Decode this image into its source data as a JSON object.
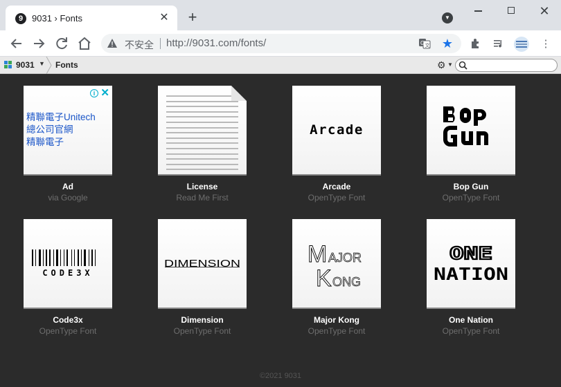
{
  "browser": {
    "tab_title": "9031 › Fonts",
    "tab_favicon": "9",
    "new_tab": "+",
    "close_tab": "✕",
    "security_label": "不安全",
    "url": "http://9031.com/fonts/"
  },
  "site": {
    "name": "9031",
    "breadcrumb": "Fonts",
    "search_value": ""
  },
  "ad": {
    "lines": [
      "精聯電子Unitech",
      "總公司官網",
      "精聯電子"
    ]
  },
  "tiles": [
    {
      "title": "Ad",
      "subtitle": "via Google",
      "preview": "ad"
    },
    {
      "title": "License",
      "subtitle": "Read Me First",
      "preview": "license"
    },
    {
      "title": "Arcade",
      "subtitle": "OpenType Font",
      "preview_text": "Arcade"
    },
    {
      "title": "Bop Gun",
      "subtitle": "OpenType Font",
      "preview_text": "Bop Gun"
    },
    {
      "title": "Code3x",
      "subtitle": "OpenType Font",
      "preview_text": "CODE3X"
    },
    {
      "title": "Dimension",
      "subtitle": "OpenType Font",
      "preview_text": "DIMENSION"
    },
    {
      "title": "Major Kong",
      "subtitle": "OpenType Font",
      "preview_text": "MAJOR KONG"
    },
    {
      "title": "One Nation",
      "subtitle": "OpenType Font",
      "preview_text": "ONE NATION"
    }
  ],
  "footer": {
    "copyright": "©2021 9031"
  },
  "colors": {
    "page_bg": "#2b2b2b",
    "ad_link": "#1a55c8",
    "star_active": "#1a73e8",
    "subtitle": "#6e6e6e"
  }
}
